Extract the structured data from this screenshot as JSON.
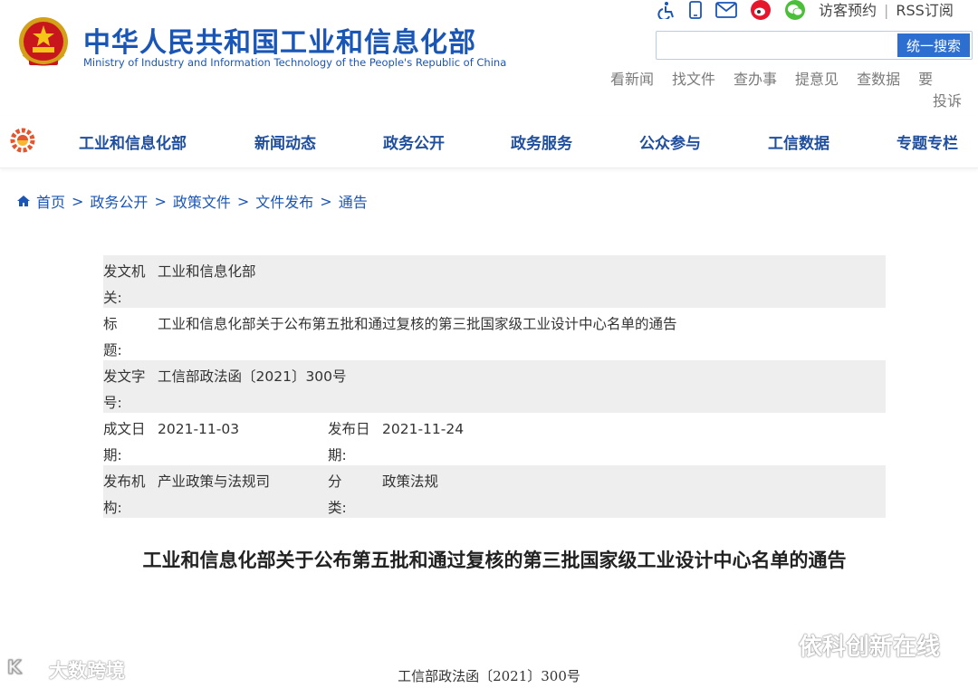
{
  "header": {
    "title": "中华人民共和国工业和信息化部",
    "subtitle": "Ministry of Industry and Information Technology of the People's Republic of China",
    "top_links": [
      "访客预约",
      "RSS订阅"
    ],
    "search": {
      "placeholder": "",
      "button_label": "统一搜索"
    },
    "quick_links": [
      "看新闻",
      "找文件",
      "查办事",
      "提意见",
      "查数据",
      "要"
    ],
    "quick_links_wrap": "投诉",
    "icons": [
      "accessibility-icon",
      "mobile-icon",
      "mail-icon",
      "weibo-icon",
      "wechat-icon"
    ]
  },
  "nav": {
    "items": [
      "工业和信息化部",
      "新闻动态",
      "政务公开",
      "政务服务",
      "公众参与",
      "工信数据",
      "专题专栏"
    ]
  },
  "breadcrumb": [
    "首页",
    "政务公开",
    "政策文件",
    "文件发布",
    "通告"
  ],
  "info": {
    "issuer_label": "发文机关:",
    "issuer": "工业和信息化部",
    "title_label": "标题:",
    "title": "工业和信息化部关于公布第五批和通过复核的第三批国家级工业设计中心名单的通告",
    "docno_label": "发文字号:",
    "docno": "工信部政法函〔2021〕300号",
    "created_label": "成文日期:",
    "created": "2021-11-03",
    "published_label": "发布日期:",
    "published": "2021-11-24",
    "org_label": "发布机构:",
    "org": "产业政策与法规司",
    "category_label": "分类:",
    "category": "政策法规"
  },
  "article": {
    "title": "工业和信息化部关于公布第五批和通过复核的第三批国家级工业设计中心名单的通告",
    "doc_number": "工信部政法函〔2021〕300号"
  },
  "watermarks": {
    "left": "大数跨境",
    "right": "依科创新在线"
  },
  "colors": {
    "brand_blue": "#1a56b5",
    "nav_blue": "#1f4f9e",
    "button_blue": "#2d6fd1",
    "row_shade": "#eeeeee"
  }
}
